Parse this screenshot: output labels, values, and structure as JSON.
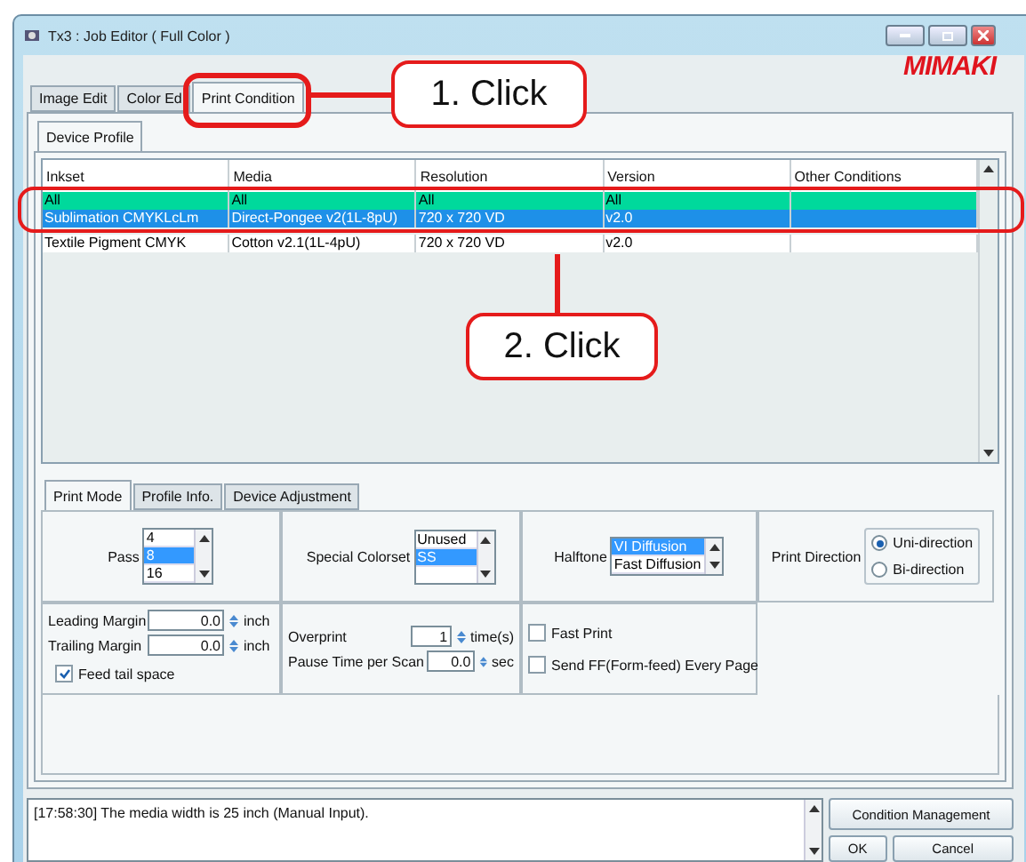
{
  "window": {
    "title": "Tx3 : Job Editor ( Full Color )",
    "logo": "MIMAKI"
  },
  "tabs": [
    {
      "label": "Image Edit",
      "selected": false
    },
    {
      "label": "Color Ed",
      "selected": false
    },
    {
      "label": "Print Condition",
      "selected": true
    }
  ],
  "subtabs": [
    {
      "label": "Device Profile",
      "selected": true
    }
  ],
  "table": {
    "columns": [
      "Inkset",
      "Media",
      "Resolution",
      "Version",
      "Other Conditions"
    ],
    "rows": [
      {
        "kind": "filter",
        "selected": false,
        "cells": [
          "All",
          "All",
          "All",
          "All",
          ""
        ]
      },
      {
        "kind": "profile",
        "selected": true,
        "cells": [
          "Sublimation CMYKLcLm",
          "Direct-Pongee v2(1L-8pU)",
          "720 x 720 VD",
          "v2.0",
          ""
        ]
      },
      {
        "kind": "profile",
        "selected": false,
        "cells": [
          "Textile Pigment CMYK",
          "Cotton v2.1(1L-4pU)",
          "720 x 720 VD",
          "v2.0",
          ""
        ]
      }
    ]
  },
  "mode_tabs": [
    {
      "label": "Print Mode",
      "selected": true
    },
    {
      "label": "Profile Info.",
      "selected": false
    },
    {
      "label": "Device Adjustment",
      "selected": false
    }
  ],
  "pass": {
    "label": "Pass",
    "items": [
      {
        "label": "4",
        "selected": false
      },
      {
        "label": "8",
        "selected": true
      },
      {
        "label": "16",
        "selected": false
      }
    ]
  },
  "special_colorset": {
    "label": "Special Colorset",
    "items": [
      {
        "label": "Unused",
        "selected": false
      },
      {
        "label": "SS",
        "selected": true
      }
    ]
  },
  "halftone": {
    "label": "Halftone",
    "items": [
      {
        "label": "VI Diffusion",
        "selected": true
      },
      {
        "label": "Fast Diffusion",
        "selected": false
      }
    ]
  },
  "print_direction": {
    "label": "Print Direction",
    "options": [
      {
        "label": "Uni-direction",
        "selected": true
      },
      {
        "label": "Bi-direction",
        "selected": false
      }
    ]
  },
  "margins": [
    {
      "label": "Leading Margin",
      "value": "0.0",
      "unit": "inch"
    },
    {
      "label": "Trailing Margin",
      "value": "0.0",
      "unit": "inch"
    }
  ],
  "feed_tail_space": {
    "label": "Feed tail space",
    "checked": true
  },
  "overprint": {
    "label": "Overprint",
    "value": "1",
    "unit": "time(s)"
  },
  "pause": {
    "label": "Pause Time per Scan",
    "value": "0.0",
    "unit": "sec"
  },
  "options": [
    {
      "label": "Fast Print",
      "checked": false
    },
    {
      "label": "Send FF(Form-feed) Every Page",
      "checked": false
    }
  ],
  "log": "[17:58:30] The media width is 25 inch (Manual Input).",
  "buttons": [
    "Condition Management",
    "OK",
    "Cancel"
  ],
  "annotations": [
    "1. Click",
    "2. Click"
  ]
}
